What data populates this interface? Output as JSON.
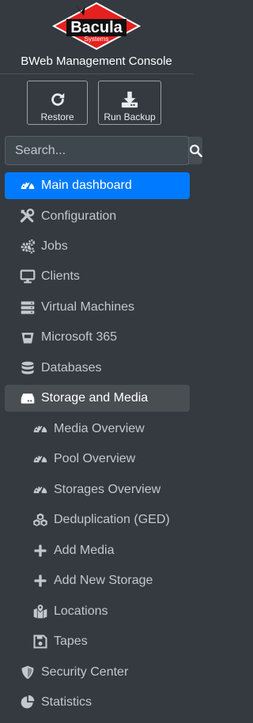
{
  "brand": {
    "logo_text": "Bacula",
    "logo_subtext": "Systems",
    "console_title": "BWeb Management Console",
    "accent_color": "#e6201e"
  },
  "actions": {
    "restore_label": "Restore",
    "run_backup_label": "Run Backup"
  },
  "search": {
    "placeholder": "Search..."
  },
  "nav": {
    "items": [
      {
        "label": "Main dashboard",
        "icon": "tachometer-icon",
        "state": "active"
      },
      {
        "label": "Configuration",
        "icon": "tools-icon"
      },
      {
        "label": "Jobs",
        "icon": "cogs-icon"
      },
      {
        "label": "Clients",
        "icon": "desktop-icon"
      },
      {
        "label": "Virtual Machines",
        "icon": "server-icon"
      },
      {
        "label": "Microsoft 365",
        "icon": "bucket-icon"
      },
      {
        "label": "Databases",
        "icon": "database-icon"
      },
      {
        "label": "Storage and Media",
        "icon": "hdd-icon",
        "state": "open"
      },
      {
        "label": "Media Overview",
        "icon": "tachometer-icon",
        "sub": true
      },
      {
        "label": "Pool Overview",
        "icon": "tachometer-icon",
        "sub": true
      },
      {
        "label": "Storages Overview",
        "icon": "tachometer-icon",
        "sub": true
      },
      {
        "label": "Deduplication (GED)",
        "icon": "cubes-icon",
        "sub": true
      },
      {
        "label": "Add Media",
        "icon": "plus-icon",
        "sub": true
      },
      {
        "label": "Add New Storage",
        "icon": "plus-icon",
        "sub": true
      },
      {
        "label": "Locations",
        "icon": "map-marked-icon",
        "sub": true
      },
      {
        "label": "Tapes",
        "icon": "save-icon",
        "sub": true
      },
      {
        "label": "Security Center",
        "icon": "shield-icon"
      },
      {
        "label": "Statistics",
        "icon": "chart-pie-icon"
      }
    ]
  }
}
